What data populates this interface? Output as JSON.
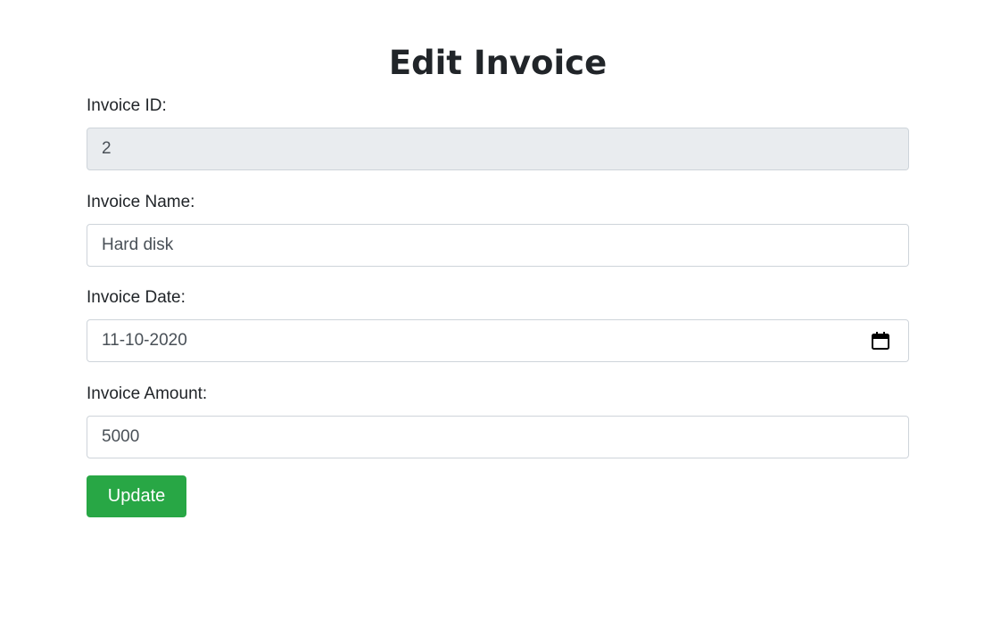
{
  "page": {
    "title": "Edit Invoice"
  },
  "form": {
    "invoice_id": {
      "label": "Invoice ID:",
      "value": "2"
    },
    "invoice_name": {
      "label": "Invoice Name:",
      "value": "Hard disk"
    },
    "invoice_date": {
      "label": "Invoice Date:",
      "value": "11-10-2020",
      "icon": "calendar-icon"
    },
    "invoice_amount": {
      "label": "Invoice Amount:",
      "value": "5000"
    },
    "submit_label": "Update"
  },
  "colors": {
    "accent": "#28a745",
    "readonly_bg": "#e9ecef",
    "border": "#ced4da"
  }
}
